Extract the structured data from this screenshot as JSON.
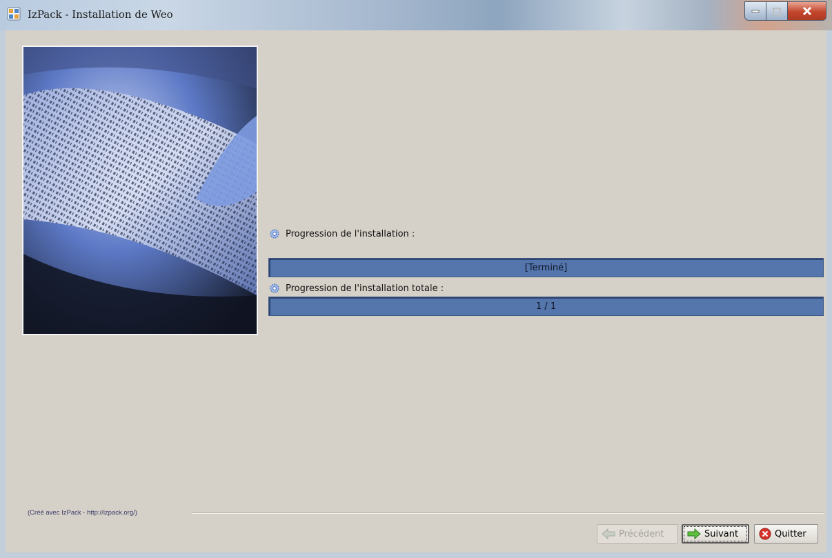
{
  "window": {
    "title": "IzPack - Installation de Weo",
    "controls": {
      "minimize": "minimize-icon",
      "maximize": "maximize-icon",
      "close": "close-icon"
    }
  },
  "panel": {
    "progress_label": "Progression de l'installation :",
    "progress_text": "[Terminé]",
    "progress_fraction": 1.0,
    "overall_label": "Progression de l'installation totale :",
    "overall_text": "1 / 1",
    "overall_fraction": 1.0
  },
  "footer": {
    "credit": "(Créé avec IzPack - http://izpack.org/)"
  },
  "buttons": {
    "previous": "Précédent",
    "next": "Suivant",
    "quit": "Quitter"
  },
  "colors": {
    "progress_fill": "#5575ad",
    "window_bg": "#d6d1c8"
  }
}
